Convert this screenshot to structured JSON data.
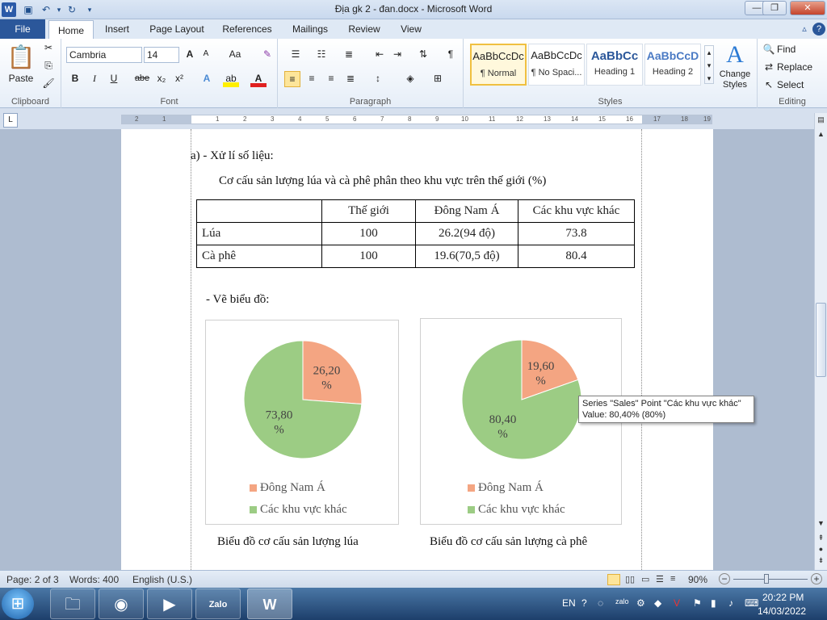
{
  "window": {
    "title": "Địa gk 2 - đan.docx - Microsoft Word"
  },
  "quick_access": {
    "save_icon": "save-icon",
    "undo_icon": "undo-icon",
    "redo_icon": "redo-icon"
  },
  "tabs": [
    {
      "label": "File"
    },
    {
      "label": "Home"
    },
    {
      "label": "Insert"
    },
    {
      "label": "Page Layout"
    },
    {
      "label": "References"
    },
    {
      "label": "Mailings"
    },
    {
      "label": "Review"
    },
    {
      "label": "View"
    }
  ],
  "ribbon": {
    "clipboard": {
      "label": "Clipboard",
      "paste": "Paste"
    },
    "font": {
      "label": "Font",
      "family": "Cambria",
      "size": "14",
      "bold": "B",
      "italic": "I",
      "underline": "U",
      "strike": "abe",
      "sub": "x₂",
      "sup": "x²",
      "grow": "A",
      "shrink": "A",
      "case": "Aa"
    },
    "paragraph": {
      "label": "Paragraph"
    },
    "styles": {
      "label": "Styles",
      "items": [
        {
          "sample": "AaBbCcDc",
          "name": "¶ Normal"
        },
        {
          "sample": "AaBbCcDc",
          "name": "¶ No Spaci..."
        },
        {
          "sample": "AaBbCc",
          "name": "Heading 1"
        },
        {
          "sample": "AaBbCcD",
          "name": "Heading 2"
        }
      ],
      "change": "Change Styles"
    },
    "editing": {
      "label": "Editing",
      "find": "Find",
      "replace": "Replace",
      "select": "Select"
    }
  },
  "ruler": {
    "ticks": [
      "2",
      "1",
      "1",
      "2",
      "3",
      "4",
      "5",
      "6",
      "7",
      "8",
      "9",
      "10",
      "11",
      "12",
      "13",
      "14",
      "15",
      "16",
      "17",
      "18",
      "19"
    ]
  },
  "document": {
    "heading_a": "a) - Xử lí số liệu:",
    "table_title": "Cơ cấu sản lượng lúa và cà phê phân theo khu vực trên thế giới (%)",
    "table": {
      "headers": [
        "",
        "Thế giới",
        "Đông Nam Á",
        "Các khu vực khác"
      ],
      "rows": [
        [
          "Lúa",
          "100",
          "26.2(94 độ)",
          "73.8"
        ],
        [
          "Cà phê",
          "100",
          "19.6(70,5 độ)",
          "80.4"
        ]
      ]
    },
    "draw_heading": "- Vẽ biểu đồ:",
    "caption_left": "Biểu đồ cơ cấu sản lượng lúa",
    "caption_right": "Biểu đồ cơ cấu sản lượng cà phê"
  },
  "chart_data": [
    {
      "type": "pie",
      "title": "",
      "categories": [
        "Đông Nam Á",
        "Các khu vực khác"
      ],
      "values": [
        26.2,
        73.8
      ],
      "data_labels": [
        "26,20 %",
        "73,80 %"
      ],
      "colors": [
        "#f4a582",
        "#9ccc84"
      ],
      "legend_position": "bottom"
    },
    {
      "type": "pie",
      "title": "",
      "categories": [
        "Đông Nam Á",
        "Các khu vực khác"
      ],
      "values": [
        19.6,
        80.4
      ],
      "data_labels": [
        "19,60 %",
        "80,40 %"
      ],
      "colors": [
        "#f4a582",
        "#9ccc84"
      ],
      "legend_position": "bottom"
    }
  ],
  "tooltip": {
    "line1": "Series \"Sales\" Point \"Các khu vực khác\"",
    "line2": "Value: 80,40% (80%)"
  },
  "status": {
    "page": "Page: 2 of 3",
    "words": "Words: 400",
    "language": "English (U.S.)",
    "zoom": "90%"
  },
  "taskbar": {
    "lang": "EN",
    "time": "20:22 PM",
    "date": "14/03/2022",
    "zalo": "Zalo"
  }
}
